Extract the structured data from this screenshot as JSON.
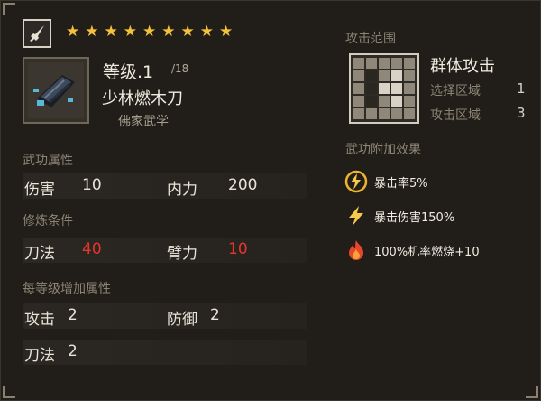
{
  "header": {
    "stars": [
      "★",
      "★",
      "★",
      "★",
      "★",
      "★",
      "★",
      "★",
      "★"
    ],
    "star_color": "#f3c23a"
  },
  "item": {
    "level_label": "等级.1",
    "level_max": "/18",
    "name": "少林燃木刀",
    "school": "佛家武学"
  },
  "sections": {
    "attributes": "武功属性",
    "requirements": "修炼条件",
    "per_level": "每等级增加属性"
  },
  "attributes": {
    "damage_label": "伤害",
    "damage_value": "10",
    "inner_label": "内力",
    "inner_value": "200"
  },
  "requirements": {
    "blade_label": "刀法",
    "blade_value": "40",
    "arm_label": "臂力",
    "arm_value": "10",
    "unmet_color": "#e6352b"
  },
  "per_level": {
    "attack_label": "攻击",
    "attack_value": "2",
    "defense_label": "防御",
    "defense_value": "2",
    "blade_label": "刀法",
    "blade_value": "2"
  },
  "range": {
    "title": "攻击范围",
    "type": "群体攻击",
    "select_label": "选择区域",
    "select_value": "1",
    "attack_label": "攻击区域",
    "attack_value": "3"
  },
  "effects": {
    "title": "武功附加效果",
    "items": [
      {
        "icon": "lightning-circle-icon",
        "text": "暴击率5%"
      },
      {
        "icon": "lightning-icon",
        "text": "暴击伤害150%"
      },
      {
        "icon": "fire-icon",
        "text": "100%机率燃烧+10"
      }
    ]
  }
}
